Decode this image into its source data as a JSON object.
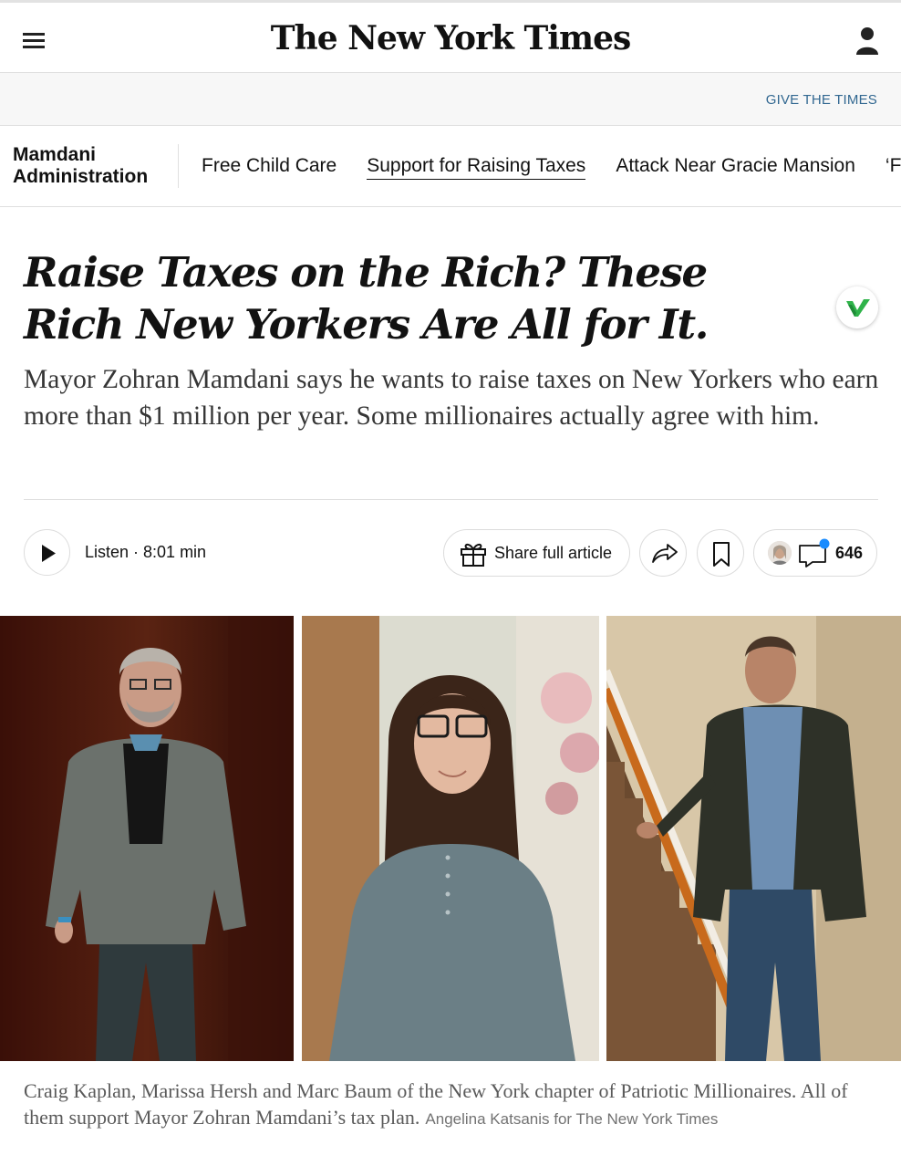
{
  "header": {
    "logo_text": "The New York Times",
    "give_link": "GIVE THE TIMES"
  },
  "subnav": {
    "title_line1": "Mamdani",
    "title_line2": "Administration",
    "items": [
      {
        "label": "Free Child Care"
      },
      {
        "label": "Support for Raising Taxes"
      },
      {
        "label": "Attack Near Gracie Mansion"
      },
      {
        "label": "‘F"
      }
    ],
    "active_index": 1
  },
  "article": {
    "headline": "Raise Taxes on the Rich? These Rich New Yorkers Are All for It.",
    "summary": "Mayor Zohran Mamdani says he wants to raise taxes on New Yorkers who earn more than $1 million per year. Some millionaires actually agree with him."
  },
  "toolbar": {
    "listen_label": "Listen · 8:01 min",
    "share_label": "Share full article",
    "comment_count": "646"
  },
  "photo_caption": {
    "text": "Craig Kaplan, Marissa Hersh and Marc Baum of the New York chapter of Patriotic Millionaires. All of them support Mayor Zohran Mamdani’s tax plan.",
    "credit": "Angelina Katsanis for The New York Times"
  },
  "colors": {
    "link_blue": "#326891",
    "text_primary": "#121212",
    "caption_gray": "#5a5a5a",
    "badge_green": "#2fb34a",
    "notification_blue": "#1a8cff"
  },
  "icons": [
    "menu-icon",
    "account-icon",
    "v-badge-icon",
    "play-icon",
    "gift-icon",
    "share-arrow-icon",
    "bookmark-icon",
    "comment-icon"
  ]
}
